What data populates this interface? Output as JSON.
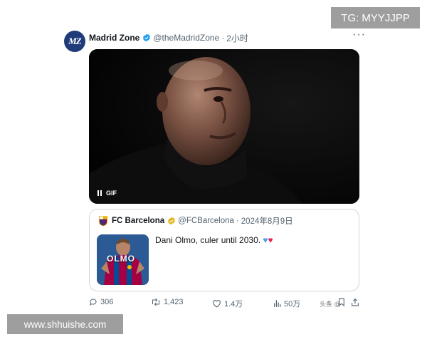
{
  "tweet": {
    "author_name": "Madrid Zone",
    "avatar_text": "MZ",
    "handle": "@theMadridZone",
    "separator": "·",
    "time": "2小时",
    "more_label": "···",
    "media": {
      "badge": "GIF"
    }
  },
  "quote": {
    "author_name": "FC Barcelona",
    "handle": "@FCBarcelona",
    "separator": "·",
    "date": "2024年8月9日",
    "text": "Dani Olmo, culer until 2030.",
    "thumb_text": "OLMO"
  },
  "actions": {
    "replies": "306",
    "reposts": "1,423",
    "likes": "1.4万",
    "views": "50万"
  },
  "overlays": {
    "tg": "TG: MYYJJPP",
    "site": "www.shhuishe.com",
    "brand": "头条 @"
  },
  "colors": {
    "verified_blue": "#1d9bf0",
    "verified_gold": "#e2b719",
    "text_secondary": "#536471",
    "heart_red": "#e0245e",
    "heart_blue": "#4aa3e0"
  }
}
